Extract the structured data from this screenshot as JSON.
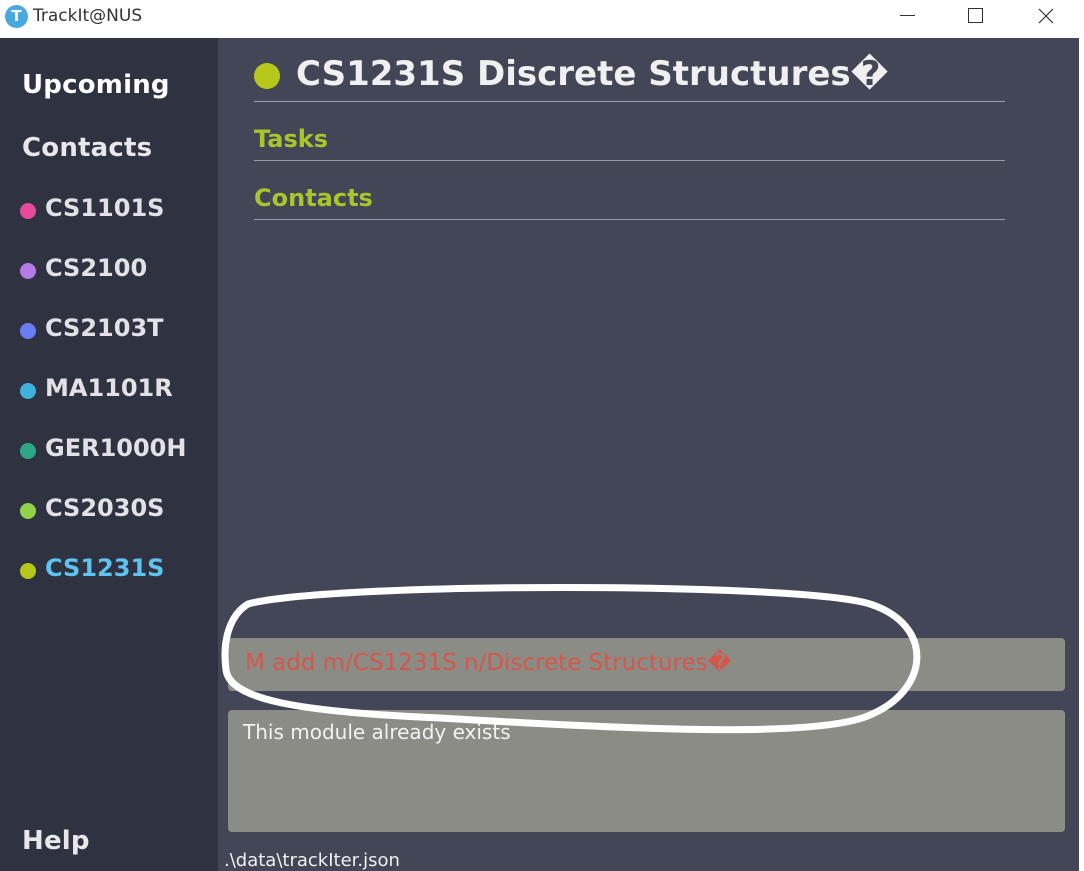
{
  "window": {
    "logo_letter": "T",
    "title": "TrackIt@NUS"
  },
  "sidebar": {
    "upcoming": "Upcoming",
    "contacts": "Contacts",
    "help": "Help",
    "modules": [
      {
        "code": "CS1101S",
        "color": "#e64a9a",
        "selected": false
      },
      {
        "code": "CS2100",
        "color": "#b57ae8",
        "selected": false
      },
      {
        "code": "CS2103T",
        "color": "#6a7cf2",
        "selected": false
      },
      {
        "code": "MA1101R",
        "color": "#3fb1dd",
        "selected": false
      },
      {
        "code": "GER1000H",
        "color": "#2fa786",
        "selected": false
      },
      {
        "code": "CS2030S",
        "color": "#8fd24a",
        "selected": false
      },
      {
        "code": "CS1231S",
        "color": "#b5c81a",
        "selected": true
      }
    ]
  },
  "main": {
    "header_title": "CS1231S Discrete Structures�",
    "header_color": "#b5c81a",
    "sections": {
      "tasks": "Tasks",
      "contacts": "Contacts"
    },
    "command": {
      "value": "M add m/CS1231S n/Discrete Structures�",
      "text_color": "#d4574a"
    },
    "result": "This module already exists",
    "status_path": ".\\data\\trackIter.json"
  },
  "colors": {
    "sidebar_bg": "#2f3341",
    "main_bg": "#434656",
    "section_accent": "#a8c62c",
    "selected_module": "#5dc3f0"
  }
}
